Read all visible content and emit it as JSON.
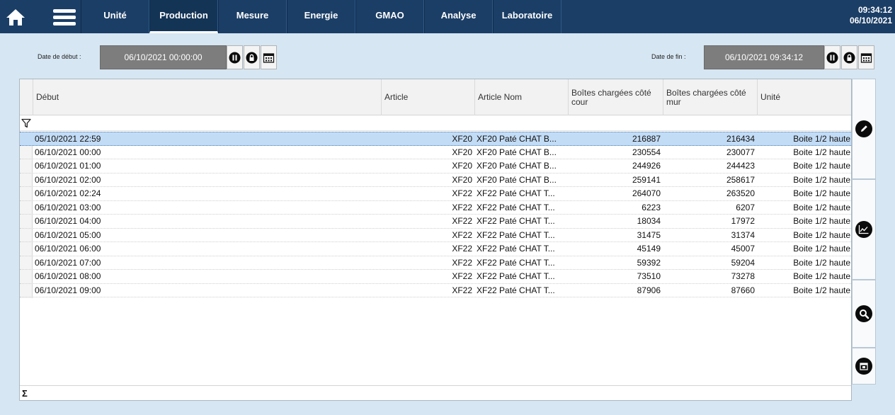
{
  "header": {
    "tabs": [
      {
        "label": "Unité",
        "active": false
      },
      {
        "label": "Production",
        "active": true
      },
      {
        "label": "Mesure",
        "active": false
      },
      {
        "label": "Energie",
        "active": false
      },
      {
        "label": "GMAO",
        "active": false
      },
      {
        "label": "Analyse",
        "active": false
      },
      {
        "label": "Laboratoire",
        "active": false
      }
    ],
    "time": "09:34:12",
    "date": "06/10/2021"
  },
  "filters": {
    "start_label": "Date de début :",
    "start_value": "06/10/2021 00:00:00",
    "end_label": "Date de fin :",
    "end_value": "06/10/2021 09:34:12"
  },
  "grid": {
    "columns": [
      "Début",
      "Article",
      "Article Nom",
      "Boîtes chargées côté cour",
      "Boîtes chargées côté mur",
      "Unité"
    ],
    "rows": [
      [
        "05/10/2021 22:59",
        "XF20",
        "XF20 Paté CHAT B...",
        "216887",
        "216434",
        "Boite 1/2 haute"
      ],
      [
        "06/10/2021 00:00",
        "XF20",
        "XF20 Paté CHAT B...",
        "230554",
        "230077",
        "Boite 1/2 haute"
      ],
      [
        "06/10/2021 01:00",
        "XF20",
        "XF20 Paté CHAT B...",
        "244926",
        "244423",
        "Boite 1/2 haute"
      ],
      [
        "06/10/2021 02:00",
        "XF20",
        "XF20 Paté CHAT B...",
        "259141",
        "258617",
        "Boite 1/2 haute"
      ],
      [
        "06/10/2021 02:24",
        "XF22",
        "XF22 Paté CHAT T...",
        "264070",
        "263520",
        "Boite 1/2 haute"
      ],
      [
        "06/10/2021 03:00",
        "XF22",
        "XF22 Paté CHAT T...",
        "6223",
        "6207",
        "Boite 1/2 haute"
      ],
      [
        "06/10/2021 04:00",
        "XF22",
        "XF22 Paté CHAT T...",
        "18034",
        "17972",
        "Boite 1/2 haute"
      ],
      [
        "06/10/2021 05:00",
        "XF22",
        "XF22 Paté CHAT T...",
        "31475",
        "31374",
        "Boite 1/2 haute"
      ],
      [
        "06/10/2021 06:00",
        "XF22",
        "XF22 Paté CHAT T...",
        "45149",
        "45007",
        "Boite 1/2 haute"
      ],
      [
        "06/10/2021 07:00",
        "XF22",
        "XF22 Paté CHAT T...",
        "59392",
        "59204",
        "Boite 1/2 haute"
      ],
      [
        "06/10/2021 08:00",
        "XF22",
        "XF22 Paté CHAT T...",
        "73510",
        "73278",
        "Boite 1/2 haute"
      ],
      [
        "06/10/2021 09:00",
        "XF22",
        "XF22 Paté CHAT T...",
        "87906",
        "87660",
        "Boite 1/2 haute"
      ]
    ],
    "selected_row": 0
  },
  "icons": {
    "home": "home-icon",
    "menu": "hamburger-menu-icon",
    "pause": "pause-icon",
    "lock": "lock-icon",
    "calendar": "calendar-icon",
    "filter": "filter-icon",
    "sum": "sigma-icon",
    "edit": "pencil-icon",
    "trend": "trend-chart-icon",
    "search": "magnifier-icon",
    "calendar_day": "calendar-day-icon"
  },
  "colors": {
    "header_bg": "#1b3e66",
    "selected_row": "#c3dcf5",
    "date_field": "#7d7d7d"
  }
}
